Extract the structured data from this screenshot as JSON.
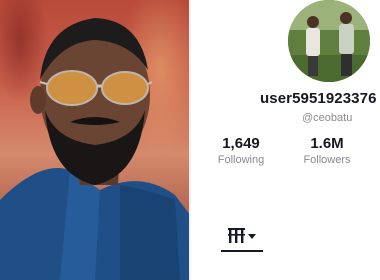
{
  "profile": {
    "username": "user5951923376",
    "handle": "@ceobatu",
    "stats": {
      "following": {
        "value": "1,649",
        "label": "Following"
      },
      "followers": {
        "value": "1.6M",
        "label": "Followers"
      }
    }
  },
  "icons": {
    "tab_grid": "grid-menu-icon",
    "dropdown": "caret-down-icon"
  },
  "colors": {
    "text_primary": "#161823",
    "text_secondary": "#8a8b91",
    "background": "#ffffff"
  }
}
